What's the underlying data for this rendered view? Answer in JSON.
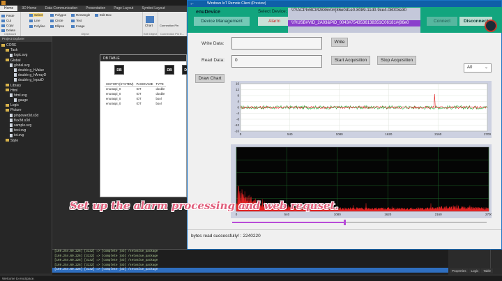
{
  "ide": {
    "ribbon_tabs": [
      "Home",
      "3D Home",
      "Data Communication",
      "Presentation",
      "Page Layout",
      "Symbol Layout"
    ],
    "ribbon": {
      "clipboard": {
        "caption": "Clipboard",
        "items": [
          "Paste",
          "Cut",
          "Copy",
          "Delete"
        ]
      },
      "object": {
        "caption": "Object",
        "col1": [
          "Select",
          "Line",
          "Polyline"
        ],
        "col2": [
          "Polygon",
          "Circle",
          "Ellipse"
        ],
        "col3": [
          "Rectangle",
          "Text",
          "Image"
        ],
        "col4": [
          "Edit Box"
        ]
      },
      "chart": {
        "caption": "Edit Object",
        "label": "Chart"
      },
      "connection": {
        "caption": "Connection Pin E...",
        "label": "Connection Pin"
      }
    },
    "explorer_title": "Project Explorer",
    "tree": [
      {
        "depth": 0,
        "kind": "folder",
        "label": "CORE"
      },
      {
        "depth": 1,
        "kind": "folder",
        "label": "Task"
      },
      {
        "depth": 2,
        "kind": "file",
        "label": "logic.svg"
      },
      {
        "depth": 1,
        "kind": "folder",
        "label": "Global"
      },
      {
        "depth": 2,
        "kind": "file",
        "label": "global.svg"
      },
      {
        "depth": 3,
        "kind": "file",
        "label": "double g_hValue"
      },
      {
        "depth": 3,
        "kind": "file",
        "label": "double g_hArrayD"
      },
      {
        "depth": 3,
        "kind": "file",
        "label": "double g_InputD"
      },
      {
        "depth": 1,
        "kind": "folder",
        "label": "Library"
      },
      {
        "depth": 1,
        "kind": "folder",
        "label": "Html"
      },
      {
        "depth": 2,
        "kind": "file",
        "label": "html.svg"
      },
      {
        "depth": 3,
        "kind": "file",
        "label": "gauge"
      },
      {
        "depth": 1,
        "kind": "folder",
        "label": "Logic"
      },
      {
        "depth": 1,
        "kind": "folder",
        "label": "Picture"
      },
      {
        "depth": 2,
        "kind": "file",
        "label": "pinpower3d.s3d"
      },
      {
        "depth": 2,
        "kind": "file",
        "label": "flux3d.s3d"
      },
      {
        "depth": 2,
        "kind": "file",
        "label": "sample.svg"
      },
      {
        "depth": 2,
        "kind": "file",
        "label": "test.svg"
      },
      {
        "depth": 2,
        "kind": "file",
        "label": "iot.svg"
      },
      {
        "depth": 1,
        "kind": "folder",
        "label": "Style"
      }
    ],
    "doc_tab": "DB TABLE",
    "db_icons": [
      "DB",
      "DB",
      "DB"
    ],
    "table": {
      "headers": [
        "HISTORY(SYSTEM)",
        "PAGENAME",
        "TYPE"
      ],
      "rows": [
        [
          "enuraspi_0",
          "IOT",
          "double"
        ],
        [
          "enuraspi_0",
          "IOT",
          "double"
        ],
        [
          "enuraspi_0",
          "IOT",
          "bool"
        ],
        [
          "enuraspi_0",
          "IOT",
          "bool"
        ]
      ]
    },
    "output_lines": [
      "[169.254.60.226] [3132] => [complete job] /setvalue_package",
      "[169.254.60.226] [3132] => [complete job] /setvalue_package",
      "[169.254.60.226] [3132] => [complete job] /setvalue_package",
      "[169.254.60.226] [3132] => [complete job] /setvalue_package",
      "[169.254.60.226] [3132] => [complete job] /setvalue_package"
    ],
    "status": "Welcome to enuSpace.",
    "right_tabs": [
      "Properties",
      "Logic",
      "Table"
    ]
  },
  "app": {
    "title": "Windows IoT Remote Client (Preview)",
    "device_name": "enuDevice",
    "device_management": "Device Management",
    "alarm": "Alarm",
    "select_device_label": "Select Device:",
    "devices": [
      "\\\\?\\ACPI#BCM2836#0#{86e0d1e0-8089-11d0-9ce4-08003e30",
      "\\\\?\\USB#VID_2A03&PID_0043#7543536138351C06181#{86e0"
    ],
    "connect": "Connect",
    "disconnect": "Disconnect",
    "write_label": "Write Data:",
    "write_value": "",
    "write_button": "Write",
    "read_label": "Read Data:",
    "read_value": "0",
    "start_button": "Start Acquisition",
    "stop_button": "Stop Acquisition",
    "channel": "A0",
    "draw_chart": "Draw Chart",
    "status_text": "bytes read successfully! : 2240220",
    "progress": 0.44,
    "caption": "Set up the alarm processing and web requset."
  },
  "colors": {
    "accent": "#12a57e",
    "selection": "#8b3fcc",
    "alarm": "#c82020",
    "series_green": "#28b23c",
    "series_red": "#e02424"
  },
  "chart_data": [
    {
      "type": "line",
      "title": "",
      "xlabel": "",
      "ylabel": "",
      "xlim": [
        0,
        2700
      ],
      "ylim": [
        -16,
        16
      ],
      "x_ticks": [
        "0",
        "540",
        "1080",
        "1620",
        "2160",
        "2700"
      ],
      "y_ticks": [
        "16",
        "12",
        "8",
        "4",
        "0",
        "-4",
        "-8",
        "-12",
        "-16"
      ],
      "series": [
        {
          "color": "#28b23c",
          "baseline": 0,
          "noise": 1.2
        },
        {
          "color": "#e02424",
          "baseline": 0,
          "noise": 0.8,
          "spike_at": 2120,
          "spike_value": 9
        }
      ],
      "grid": true
    },
    {
      "type": "area",
      "title": "",
      "xlabel": "",
      "ylabel": "",
      "xlim": [
        0,
        2700
      ],
      "ylim": [
        0,
        100
      ],
      "x_ticks": [
        "0",
        "540",
        "1080",
        "1620",
        "2160",
        "2700"
      ],
      "series": [
        {
          "color": "#e02424",
          "shape": "decaying spectrum",
          "peak": 38
        }
      ],
      "grid": true
    }
  ]
}
